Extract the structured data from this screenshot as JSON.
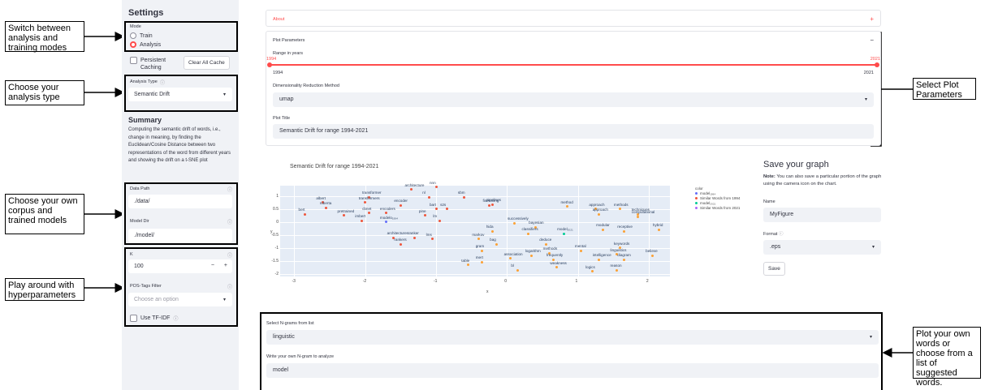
{
  "sidebar": {
    "title": "Settings",
    "mode_label": "Mode",
    "mode_options": [
      "Train",
      "Analysis"
    ],
    "mode_selected": "Analysis",
    "persistent_caching_label": "Persistent Caching",
    "clear_cache_label": "Clear All Cache",
    "analysis_type_label": "Analysis Type",
    "analysis_type_value": "Semantic Drift",
    "summary_title": "Summary",
    "summary_text": "Computing the semantic drift of words, i.e., change in meaning, by finding the Euclidean/Cosine Distance between two representations of the word from different years and showing the drift on a t-SNE plot",
    "data_path_label": "Data Path",
    "data_path_value": "./data/",
    "model_dir_label": "Model Dir",
    "model_dir_value": "./model/",
    "k_label": "K",
    "k_value": "100",
    "k_minus": "−",
    "k_plus": "+",
    "pos_filter_label": "POS-Tags Filter",
    "pos_filter_placeholder": "Choose an option",
    "tfidf_label": "Use TF-IDF"
  },
  "callouts": {
    "mode": "Switch between analysis and training modes",
    "analysis_type": "Choose your analysis type",
    "corpus": "Choose your own corpus and trained models",
    "hyper": "Play around with hyperparameters",
    "plot_params": "Select Plot Parameters",
    "words": "Plot your own words or choose from a list of suggested words."
  },
  "main": {
    "about_label": "About",
    "about_toggle": "+",
    "plot_params_label": "Plot Parameters",
    "plot_params_toggle": "−",
    "range_label": "Range in years",
    "range_min": "1994",
    "range_max": "2021",
    "range_sel_min": "1994",
    "range_sel_max": "2021",
    "dim_red_label": "Dimensionality Reduction Method",
    "dim_red_value": "umap",
    "plot_title_label": "Plot Title",
    "plot_title_value": "Semantic Drift for range 1994-2021",
    "ngram_select_label": "Select N-grams from list",
    "ngram_select_value": "linguistic",
    "ngram_input_label": "Write your own N-gram to analyze",
    "ngram_input_value": "model"
  },
  "save": {
    "title": "Save your graph",
    "note_bold": "Note:",
    "note_text": " You can also save a particular portion of the graph using the camera icon on the chart.",
    "name_label": "Name",
    "name_value": "MyFigure",
    "format_label": "Format",
    "format_value": ".eps",
    "save_button": "Save"
  },
  "chart_data": {
    "type": "scatter",
    "title": "Semantic Drift for range 1994-2021",
    "xlabel": "x",
    "ylabel": "y",
    "xlim": [
      -3.2,
      2.3
    ],
    "ylim": [
      -2.1,
      1.4
    ],
    "x_ticks": [
      "-3",
      "-2",
      "-1",
      "0",
      "1",
      "2"
    ],
    "y_ticks": [
      "1",
      "0.5",
      "0",
      "-0.5",
      "-1",
      "-1.5",
      "-2"
    ],
    "legend_title": "color",
    "legend_placement": "right",
    "legend": [
      {
        "name": "model₁₉₉₄",
        "color": "#636efa"
      },
      {
        "name": "Similar Words from 1994",
        "color": "#ef553b"
      },
      {
        "name": "model₂₀₂₁",
        "color": "#00cc96"
      },
      {
        "name": "Similar Words from 2021",
        "color": "#ab63fa"
      }
    ],
    "points": [
      {
        "label": "bert",
        "x": -2.85,
        "y": 0.3,
        "color": "#ef553b"
      },
      {
        "label": "albert",
        "x": -2.6,
        "y": 0.75,
        "color": "#ef553b"
      },
      {
        "label": "roberta",
        "x": -2.55,
        "y": 0.55,
        "color": "#ef553b"
      },
      {
        "label": "pretrained",
        "x": -2.3,
        "y": 0.25,
        "color": "#ef553b"
      },
      {
        "label": "imbert",
        "x": -2.05,
        "y": 0.05,
        "color": "#ef553b"
      },
      {
        "label": "transformer",
        "x": -1.95,
        "y": 0.95,
        "color": "#ef553b"
      },
      {
        "label": "transformers",
        "x": -2.0,
        "y": 0.75,
        "color": "#ef553b"
      },
      {
        "label": "cbnet",
        "x": -1.95,
        "y": 0.35,
        "color": "#ef553b"
      },
      {
        "label": "encoders",
        "x": -1.7,
        "y": 0.35,
        "color": "#ef553b"
      },
      {
        "label": "modelo₁₉₉₄",
        "x": -1.7,
        "y": 0.0,
        "color": "#636efa"
      },
      {
        "label": "encoder",
        "x": -1.5,
        "y": 0.65,
        "color": "#ef553b"
      },
      {
        "label": "architecture",
        "x": -1.35,
        "y": 1.25,
        "color": "#ef553b"
      },
      {
        "label": "nnn",
        "x": -1.0,
        "y": 1.35,
        "color": "#ef553b"
      },
      {
        "label": "nl",
        "x": -1.1,
        "y": 0.95,
        "color": "#ef553b"
      },
      {
        "label": "sbm",
        "x": -0.6,
        "y": 0.95,
        "color": "#ef553b"
      },
      {
        "label": "bart",
        "x": -1.0,
        "y": 0.5,
        "color": "#ef553b"
      },
      {
        "label": "s2s",
        "x": -0.85,
        "y": 0.5,
        "color": "#ef553b"
      },
      {
        "label": "pine",
        "x": -1.15,
        "y": 0.25,
        "color": "#ef553b"
      },
      {
        "label": "lm",
        "x": -0.95,
        "y": 0.05,
        "color": "#ef553b"
      },
      {
        "label": "finetuning",
        "x": -0.25,
        "y": 0.65,
        "color": "#ef553b"
      },
      {
        "label": "pipelines",
        "x": -0.2,
        "y": 0.68,
        "color": "#ef553b"
      },
      {
        "label": "architectures",
        "x": -1.6,
        "y": -0.6,
        "color": "#ef553b"
      },
      {
        "label": "rankers",
        "x": -1.5,
        "y": -0.85,
        "color": "#ef553b"
      },
      {
        "label": "ranker",
        "x": -1.3,
        "y": -0.6,
        "color": "#ef553b"
      },
      {
        "label": "lms",
        "x": -1.05,
        "y": -0.65,
        "color": "#ef553b"
      },
      {
        "label": "successively",
        "x": 0.1,
        "y": -0.05,
        "color": "#fba134"
      },
      {
        "label": "bayesian",
        "x": 0.4,
        "y": -0.2,
        "color": "#fba134"
      },
      {
        "label": "method",
        "x": 0.85,
        "y": 0.6,
        "color": "#fba134"
      },
      {
        "label": "hida",
        "x": -0.2,
        "y": -0.35,
        "color": "#fba134"
      },
      {
        "label": "classifiers",
        "x": 0.3,
        "y": -0.45,
        "color": "#fba134"
      },
      {
        "label": "model₂₀₂₁",
        "x": 0.8,
        "y": -0.45,
        "color": "#00cc96"
      },
      {
        "label": "markov",
        "x": -0.4,
        "y": -0.65,
        "color": "#fba134"
      },
      {
        "label": "bag",
        "x": -0.15,
        "y": -0.85,
        "color": "#fba134"
      },
      {
        "label": "deduce",
        "x": 0.55,
        "y": -0.85,
        "color": "#fba134"
      },
      {
        "label": "gram",
        "x": -0.35,
        "y": -1.1,
        "color": "#fba134"
      },
      {
        "label": "association",
        "x": 0.05,
        "y": -1.4,
        "color": "#fba134"
      },
      {
        "label": "logarithm",
        "x": 0.35,
        "y": -1.3,
        "color": "#fba134"
      },
      {
        "label": "methods",
        "x": 0.6,
        "y": -1.2,
        "color": "#fba134"
      },
      {
        "label": "frequently",
        "x": 0.65,
        "y": -1.45,
        "color": "#fba134"
      },
      {
        "label": "mert",
        "x": -0.35,
        "y": -1.55,
        "color": "#fba134"
      },
      {
        "label": "table",
        "x": -0.55,
        "y": -1.65,
        "color": "#fba134"
      },
      {
        "label": "bl",
        "x": 0.15,
        "y": -1.85,
        "color": "#fba134"
      },
      {
        "label": "weakness",
        "x": 0.7,
        "y": -1.75,
        "color": "#fba134"
      },
      {
        "label": "approach",
        "x": 1.25,
        "y": 0.5,
        "color": "#fba134"
      },
      {
        "label": "approach",
        "x": 1.3,
        "y": 0.3,
        "color": "#fba134"
      },
      {
        "label": "methods",
        "x": 1.6,
        "y": 0.5,
        "color": "#fba134"
      },
      {
        "label": "techniques",
        "x": 1.85,
        "y": 0.3,
        "color": "#fba134"
      },
      {
        "label": "computational",
        "x": 1.85,
        "y": 0.2,
        "color": "#fba134"
      },
      {
        "label": "hybrid",
        "x": 2.15,
        "y": -0.3,
        "color": "#fba134"
      },
      {
        "label": "modular",
        "x": 1.35,
        "y": -0.3,
        "color": "#fba134"
      },
      {
        "label": "receptive",
        "x": 1.65,
        "y": -0.35,
        "color": "#fba134"
      },
      {
        "label": "mental",
        "x": 1.05,
        "y": -1.1,
        "color": "#fba134"
      },
      {
        "label": "keywords",
        "x": 1.6,
        "y": -1.0,
        "color": "#fba134"
      },
      {
        "label": "linguistics",
        "x": 1.55,
        "y": -1.25,
        "color": "#fba134"
      },
      {
        "label": "intelligence",
        "x": 1.3,
        "y": -1.45,
        "color": "#fba134"
      },
      {
        "label": "diagram",
        "x": 1.65,
        "y": -1.45,
        "color": "#fba134"
      },
      {
        "label": "believe",
        "x": 2.05,
        "y": -1.3,
        "color": "#fba134"
      },
      {
        "label": "logics",
        "x": 1.2,
        "y": -1.9,
        "color": "#fba134"
      },
      {
        "label": "reason",
        "x": 1.55,
        "y": -1.85,
        "color": "#fba134"
      }
    ]
  }
}
